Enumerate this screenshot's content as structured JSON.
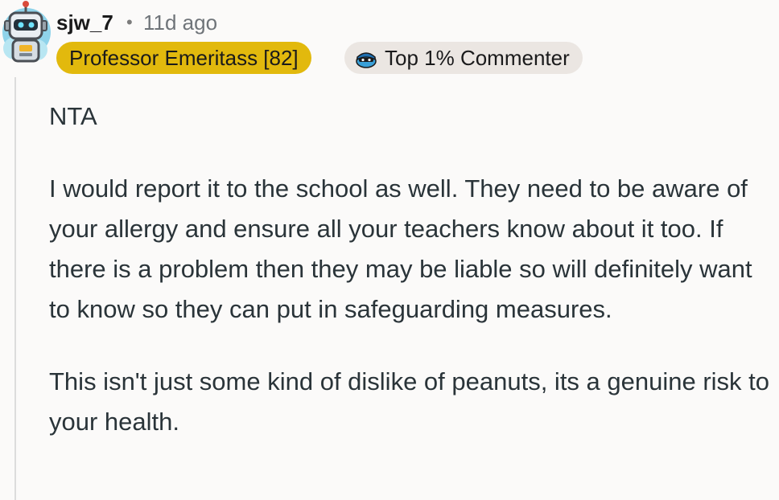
{
  "comment": {
    "author": "sjw_7",
    "separator": "•",
    "timestamp": "11d ago",
    "flairs": {
      "primary": "Professor Emeritass [82]",
      "primary_color": "#e2b90d",
      "secondary": "Top 1% Commenter",
      "secondary_icon": "top-commenter-badge-icon",
      "secondary_color": "#ebe6e2"
    },
    "avatar_icon": "robot-avatar-icon",
    "paragraphs": [
      "NTA",
      "I would report it to the school as well. They need to be aware of your allergy and ensure all your teachers know about it too. If there is a problem then they may be liable so will definitely want to know so they can put in safeguarding measures.",
      "This isn't just some kind of dislike of peanuts, its a genuine risk to your health."
    ]
  }
}
